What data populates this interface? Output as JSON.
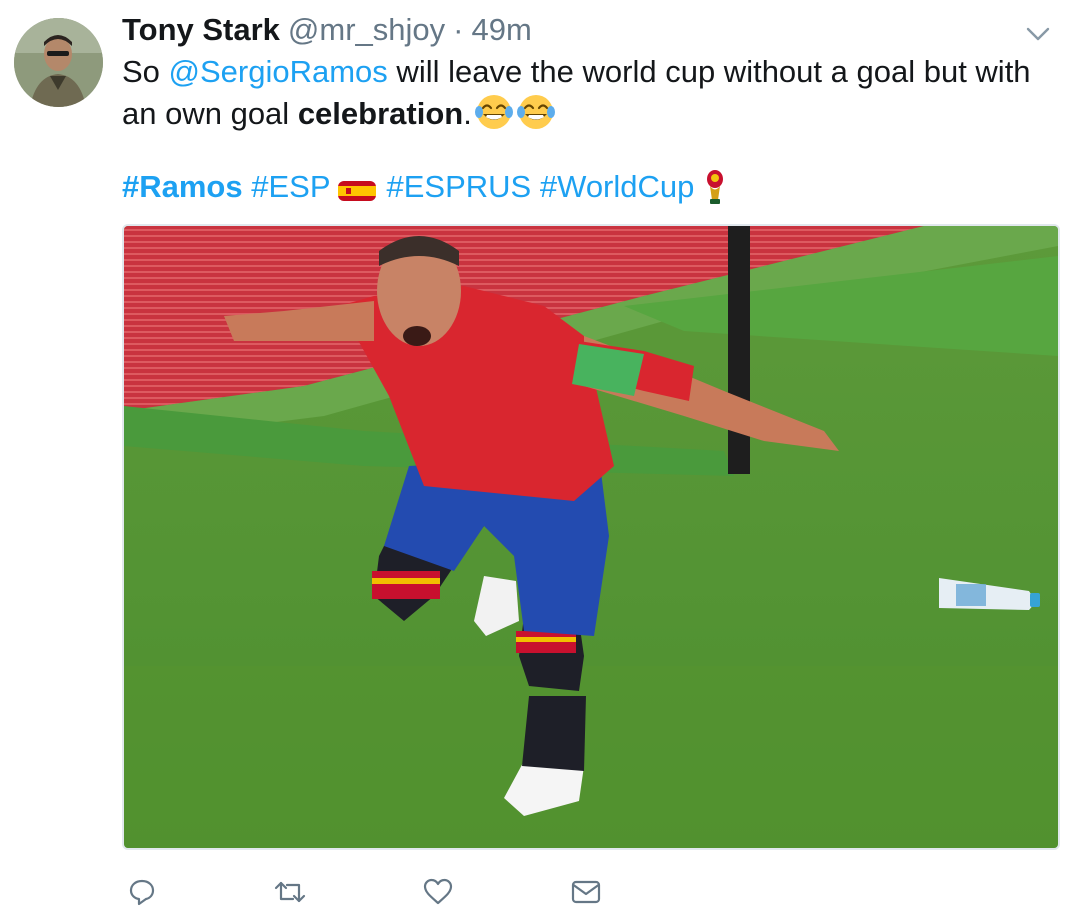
{
  "tweet": {
    "author_name": "Tony Stark",
    "author_handle": "@mr_shjoy",
    "separator": "·",
    "time": "49m",
    "text_prefix": "So ",
    "mention": "@SergioRamos",
    "text_middle": " will leave the world cup without a goal but with an own goal ",
    "text_bold": "celebration",
    "text_suffix": ".",
    "emoji": "face-with-tears-of-joy",
    "hashtags": [
      "#Ramos",
      "#ESP",
      "#ESPRUS",
      "#WorldCup"
    ],
    "media_description": "photo"
  },
  "actions": {
    "reply_icon": "reply-icon",
    "retweet_icon": "retweet-icon",
    "like_icon": "heart-icon",
    "dm_icon": "envelope-icon"
  },
  "colors": {
    "link": "#1da1f2",
    "text": "#14171a",
    "secondary": "#657786",
    "icon": "#657786"
  }
}
